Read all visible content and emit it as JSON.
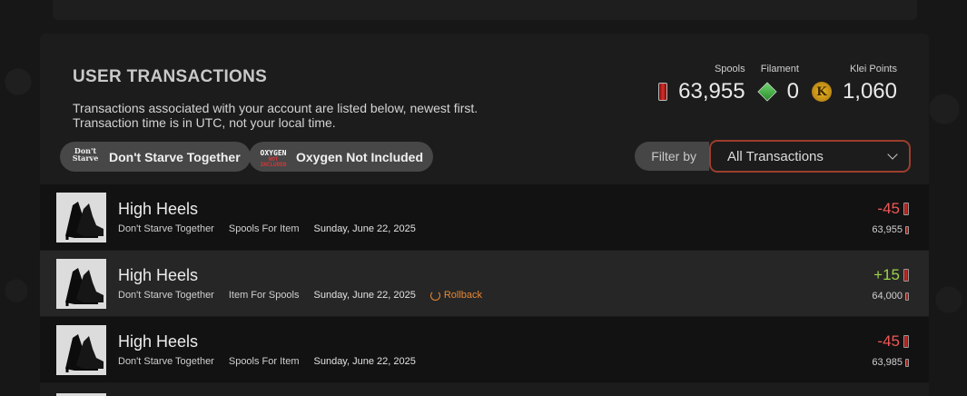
{
  "header": {
    "title": "USER TRANSACTIONS",
    "description_line1": "Transactions associated with your account are listed below, newest first.",
    "description_line2": "Transaction time is in UTC, not your local time."
  },
  "balances": {
    "spools": {
      "label": "Spools",
      "value": "63,955",
      "icon": "spool-icon"
    },
    "filament": {
      "label": "Filament",
      "value": "0",
      "icon": "filament-icon"
    },
    "klei_points": {
      "label": "Klei Points",
      "value": "1,060",
      "icon": "klei-coin-icon"
    }
  },
  "games": [
    {
      "label": "Don't Starve Together",
      "logo": "DST logo"
    },
    {
      "label": "Oxygen Not Included",
      "logo": "ONI logo"
    }
  ],
  "filter": {
    "label": "Filter by",
    "selected": "All Transactions"
  },
  "transactions": [
    {
      "item": "High Heels",
      "game": "Don't Starve Together",
      "type": "Spools For Item",
      "date": "Sunday, June 22, 2025",
      "amount": "-45",
      "balance_after": "63,955",
      "rollback": ""
    },
    {
      "item": "High Heels",
      "game": "Don't Starve Together",
      "type": "Item For Spools",
      "date": "Sunday, June 22, 2025",
      "amount": "+15",
      "balance_after": "64,000",
      "rollback": "Rollback"
    },
    {
      "item": "High Heels",
      "game": "Don't Starve Together",
      "type": "Spools For Item",
      "date": "Sunday, June 22, 2025",
      "amount": "-45",
      "balance_after": "63,985",
      "rollback": ""
    }
  ],
  "colors": {
    "negative": "#f25757",
    "positive": "#9ed24a",
    "rollback": "#e98833",
    "filter_border": "#9b3e2c"
  }
}
